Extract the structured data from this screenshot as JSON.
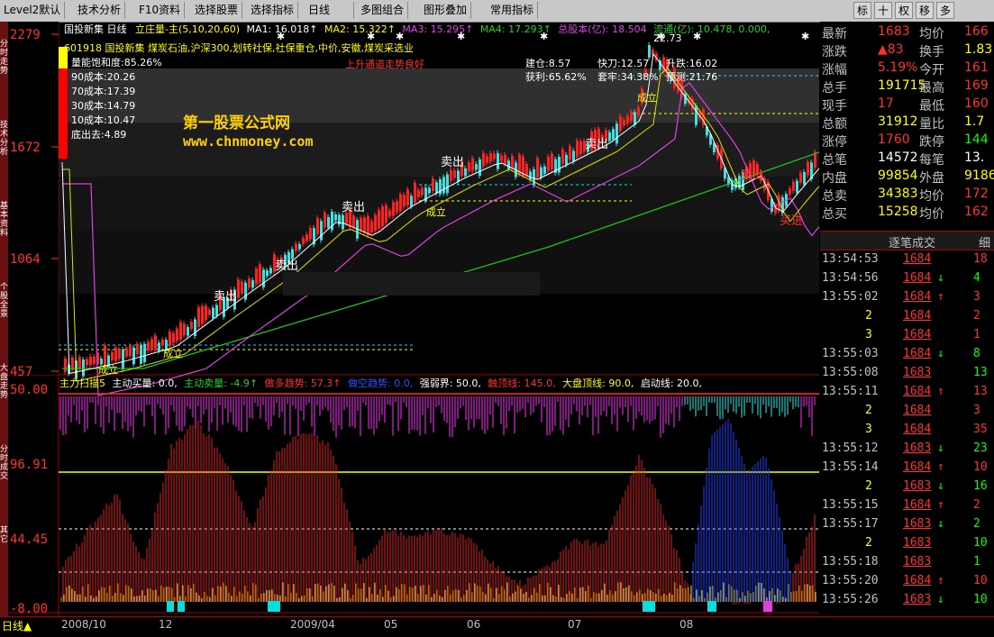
{
  "toolbar": {
    "items": [
      "Level2默认",
      "技术分析",
      "F10资料",
      "选择股票",
      "选择指标",
      "日线",
      "多图组合",
      "图形叠加",
      "常用指标"
    ],
    "right_items": [
      "标",
      "十",
      "权",
      "移",
      "多"
    ]
  },
  "left_tabs": [
    "分时走势",
    "技术分析",
    "基本资料",
    "个股全景",
    "大盘走势",
    "分时成交",
    "其它"
  ],
  "header": {
    "title": "国投新集 日线",
    "indicator": "立庄量-主(5,10,20,60)",
    "ma1": "MA1: 16.018↑",
    "ma2": "MA2: 15.322↑",
    "ma3": "MA3: 15.295↑",
    "ma4": "MA4: 17.293↑",
    "total_shares": "总股本(亿): 18.504",
    "float_shares": "流通(亿): 10.478, 0.000,"
  },
  "info": {
    "concept": "601918 国投新集 煤炭石油,沪深300,划转社保,社保重仓,中价,安徽,煤炭采选业",
    "energy": "量能饱和度:85.26%",
    "cost90": "90成本:20.26",
    "cost70": "70成本:17.39",
    "cost30": "30成本:14.79",
    "cost10": "10成本:10.47",
    "bottom_cost": "底出去:4.89",
    "trend": "上升通道走势良好",
    "jiancang": "建仓:8.57",
    "huoli": "获利:65.62%",
    "kuaidao": "快刀:12.57",
    "taolao": "套牢:34.38%",
    "shengdie": "升跌:16.02",
    "yuce": "预测:21.76",
    "peak": "22.73"
  },
  "watermark": {
    "name": "第一股票公式网",
    "url": "www.chnmoney.com"
  },
  "price_axis": [
    "2279",
    "1672",
    "1064",
    "457"
  ],
  "chart_labels": {
    "sell": "卖出",
    "buy": "买进",
    "deal": "成立"
  },
  "sub_header": {
    "name": "主力扫描5",
    "buy": "主动买量: 0.0,",
    "sell": "主动卖量: -4.9↑",
    "bull": "做多趋势: 57.3↑",
    "bear": "做空趋势: 0.0,",
    "strong": "强弱界: 50.0,",
    "top": "触顶线: 145.0,",
    "dapan": "大盘顶线: 90.0,",
    "start": "启动线: 20.0,"
  },
  "sub_axis": [
    "50.00",
    "96.91",
    "44.45",
    "-8.00"
  ],
  "date_axis": [
    "日线▲",
    "2008/10",
    "12",
    "2009/04",
    "05",
    "06",
    "07",
    "08"
  ],
  "quote": [
    {
      "l1": "最新",
      "v1": "1683",
      "c1": "#ff3030",
      "l2": "均价",
      "v2": "166",
      "c2": "#ff3030"
    },
    {
      "l1": "涨跌",
      "v1": "▲83",
      "c1": "#ff3030",
      "l2": "换手",
      "v2": "1.83",
      "c2": "#ffff00"
    },
    {
      "l1": "涨幅",
      "v1": "5.19%",
      "c1": "#ff3030",
      "l2": "今开",
      "v2": "161",
      "c2": "#ff3030"
    },
    {
      "l1": "总手",
      "v1": "191715",
      "c1": "#ffff00",
      "l2": "最高",
      "v2": "169",
      "c2": "#ff3030"
    },
    {
      "l1": "现手",
      "v1": "17",
      "c1": "#ff3030",
      "l2": "最低",
      "v2": "160",
      "c2": "#ff3030"
    },
    {
      "l1": "总额",
      "v1": "31912",
      "c1": "#ffff00",
      "l2": "量比",
      "v2": "1.7",
      "c2": "#ffff00"
    },
    {
      "l1": "涨停",
      "v1": "1760",
      "c1": "#ff3030",
      "l2": "跌停",
      "v2": "144",
      "c2": "#00ff00"
    },
    {
      "l1": "总笔",
      "v1": "14572",
      "c1": "#ffffff",
      "l2": "每笔",
      "v2": "13.",
      "c2": "#ffffff"
    },
    {
      "l1": "内盘",
      "v1": "99854",
      "c1": "#ffff00",
      "l2": "外盘",
      "v2": "9186",
      "c2": "#ffff00"
    },
    {
      "l1": "总卖",
      "v1": "34383",
      "c1": "#ffff00",
      "l2": "均价",
      "v2": "172",
      "c2": "#ff3030"
    },
    {
      "l1": "总买",
      "v1": "15258",
      "c1": "#ffff00",
      "l2": "均价",
      "v2": "162",
      "c2": "#ff3030"
    }
  ],
  "trades_title": "逐笔成交",
  "trades_tab2": "细",
  "trades": [
    {
      "t": "13:54:53",
      "p": "1684",
      "d": "",
      "v": "18",
      "pc": "#ff3030",
      "vc": "#ff3030"
    },
    {
      "t": "13:54:56",
      "p": "1684",
      "d": "↓",
      "v": "4",
      "pc": "#ff3030",
      "vc": "#00ff00"
    },
    {
      "t": "13:55:02",
      "p": "1684",
      "d": "↑",
      "v": "3",
      "pc": "#ff3030",
      "vc": "#ff3030"
    },
    {
      "t": "2",
      "p": "1684",
      "d": "",
      "v": "2",
      "pc": "#ff3030",
      "vc": "#ff3030"
    },
    {
      "t": "3",
      "p": "1684",
      "d": "",
      "v": "1",
      "pc": "#ff3030",
      "vc": "#ff3030"
    },
    {
      "t": "13:55:03",
      "p": "1684",
      "d": "↓",
      "v": "8",
      "pc": "#ff3030",
      "vc": "#00ff00"
    },
    {
      "t": "13:55:08",
      "p": "1683",
      "d": "",
      "v": "13",
      "pc": "#ff3030",
      "vc": "#00ff00"
    },
    {
      "t": "13:55:11",
      "p": "1684",
      "d": "↑",
      "v": "13",
      "pc": "#ff3030",
      "vc": "#ff3030"
    },
    {
      "t": "2",
      "p": "1684",
      "d": "",
      "v": "3",
      "pc": "#ff3030",
      "vc": "#ff3030"
    },
    {
      "t": "3",
      "p": "1684",
      "d": "",
      "v": "35",
      "pc": "#ff3030",
      "vc": "#ff3030"
    },
    {
      "t": "13:55:12",
      "p": "1683",
      "d": "↓",
      "v": "23",
      "pc": "#ff3030",
      "vc": "#00ff00"
    },
    {
      "t": "13:55:14",
      "p": "1684",
      "d": "↑",
      "v": "10",
      "pc": "#ff3030",
      "vc": "#ff3030"
    },
    {
      "t": "2",
      "p": "1683",
      "d": "↓",
      "v": "16",
      "pc": "#ff3030",
      "vc": "#00ff00"
    },
    {
      "t": "13:55:15",
      "p": "1684",
      "d": "↑",
      "v": "2",
      "pc": "#ff3030",
      "vc": "#ff3030"
    },
    {
      "t": "13:55:17",
      "p": "1683",
      "d": "↓",
      "v": "2",
      "pc": "#ff3030",
      "vc": "#00ff00"
    },
    {
      "t": "2",
      "p": "1683",
      "d": "",
      "v": "10",
      "pc": "#ff3030",
      "vc": "#00ff00"
    },
    {
      "t": "13:55:18",
      "p": "1683",
      "d": "",
      "v": "1",
      "pc": "#ff3030",
      "vc": "#00ff00"
    },
    {
      "t": "13:55:20",
      "p": "1684",
      "d": "↑",
      "v": "10",
      "pc": "#ff3030",
      "vc": "#ff3030"
    },
    {
      "t": "13:55:26",
      "p": "1683",
      "d": "↓",
      "v": "10",
      "pc": "#ff3030",
      "vc": "#00ff00"
    }
  ]
}
